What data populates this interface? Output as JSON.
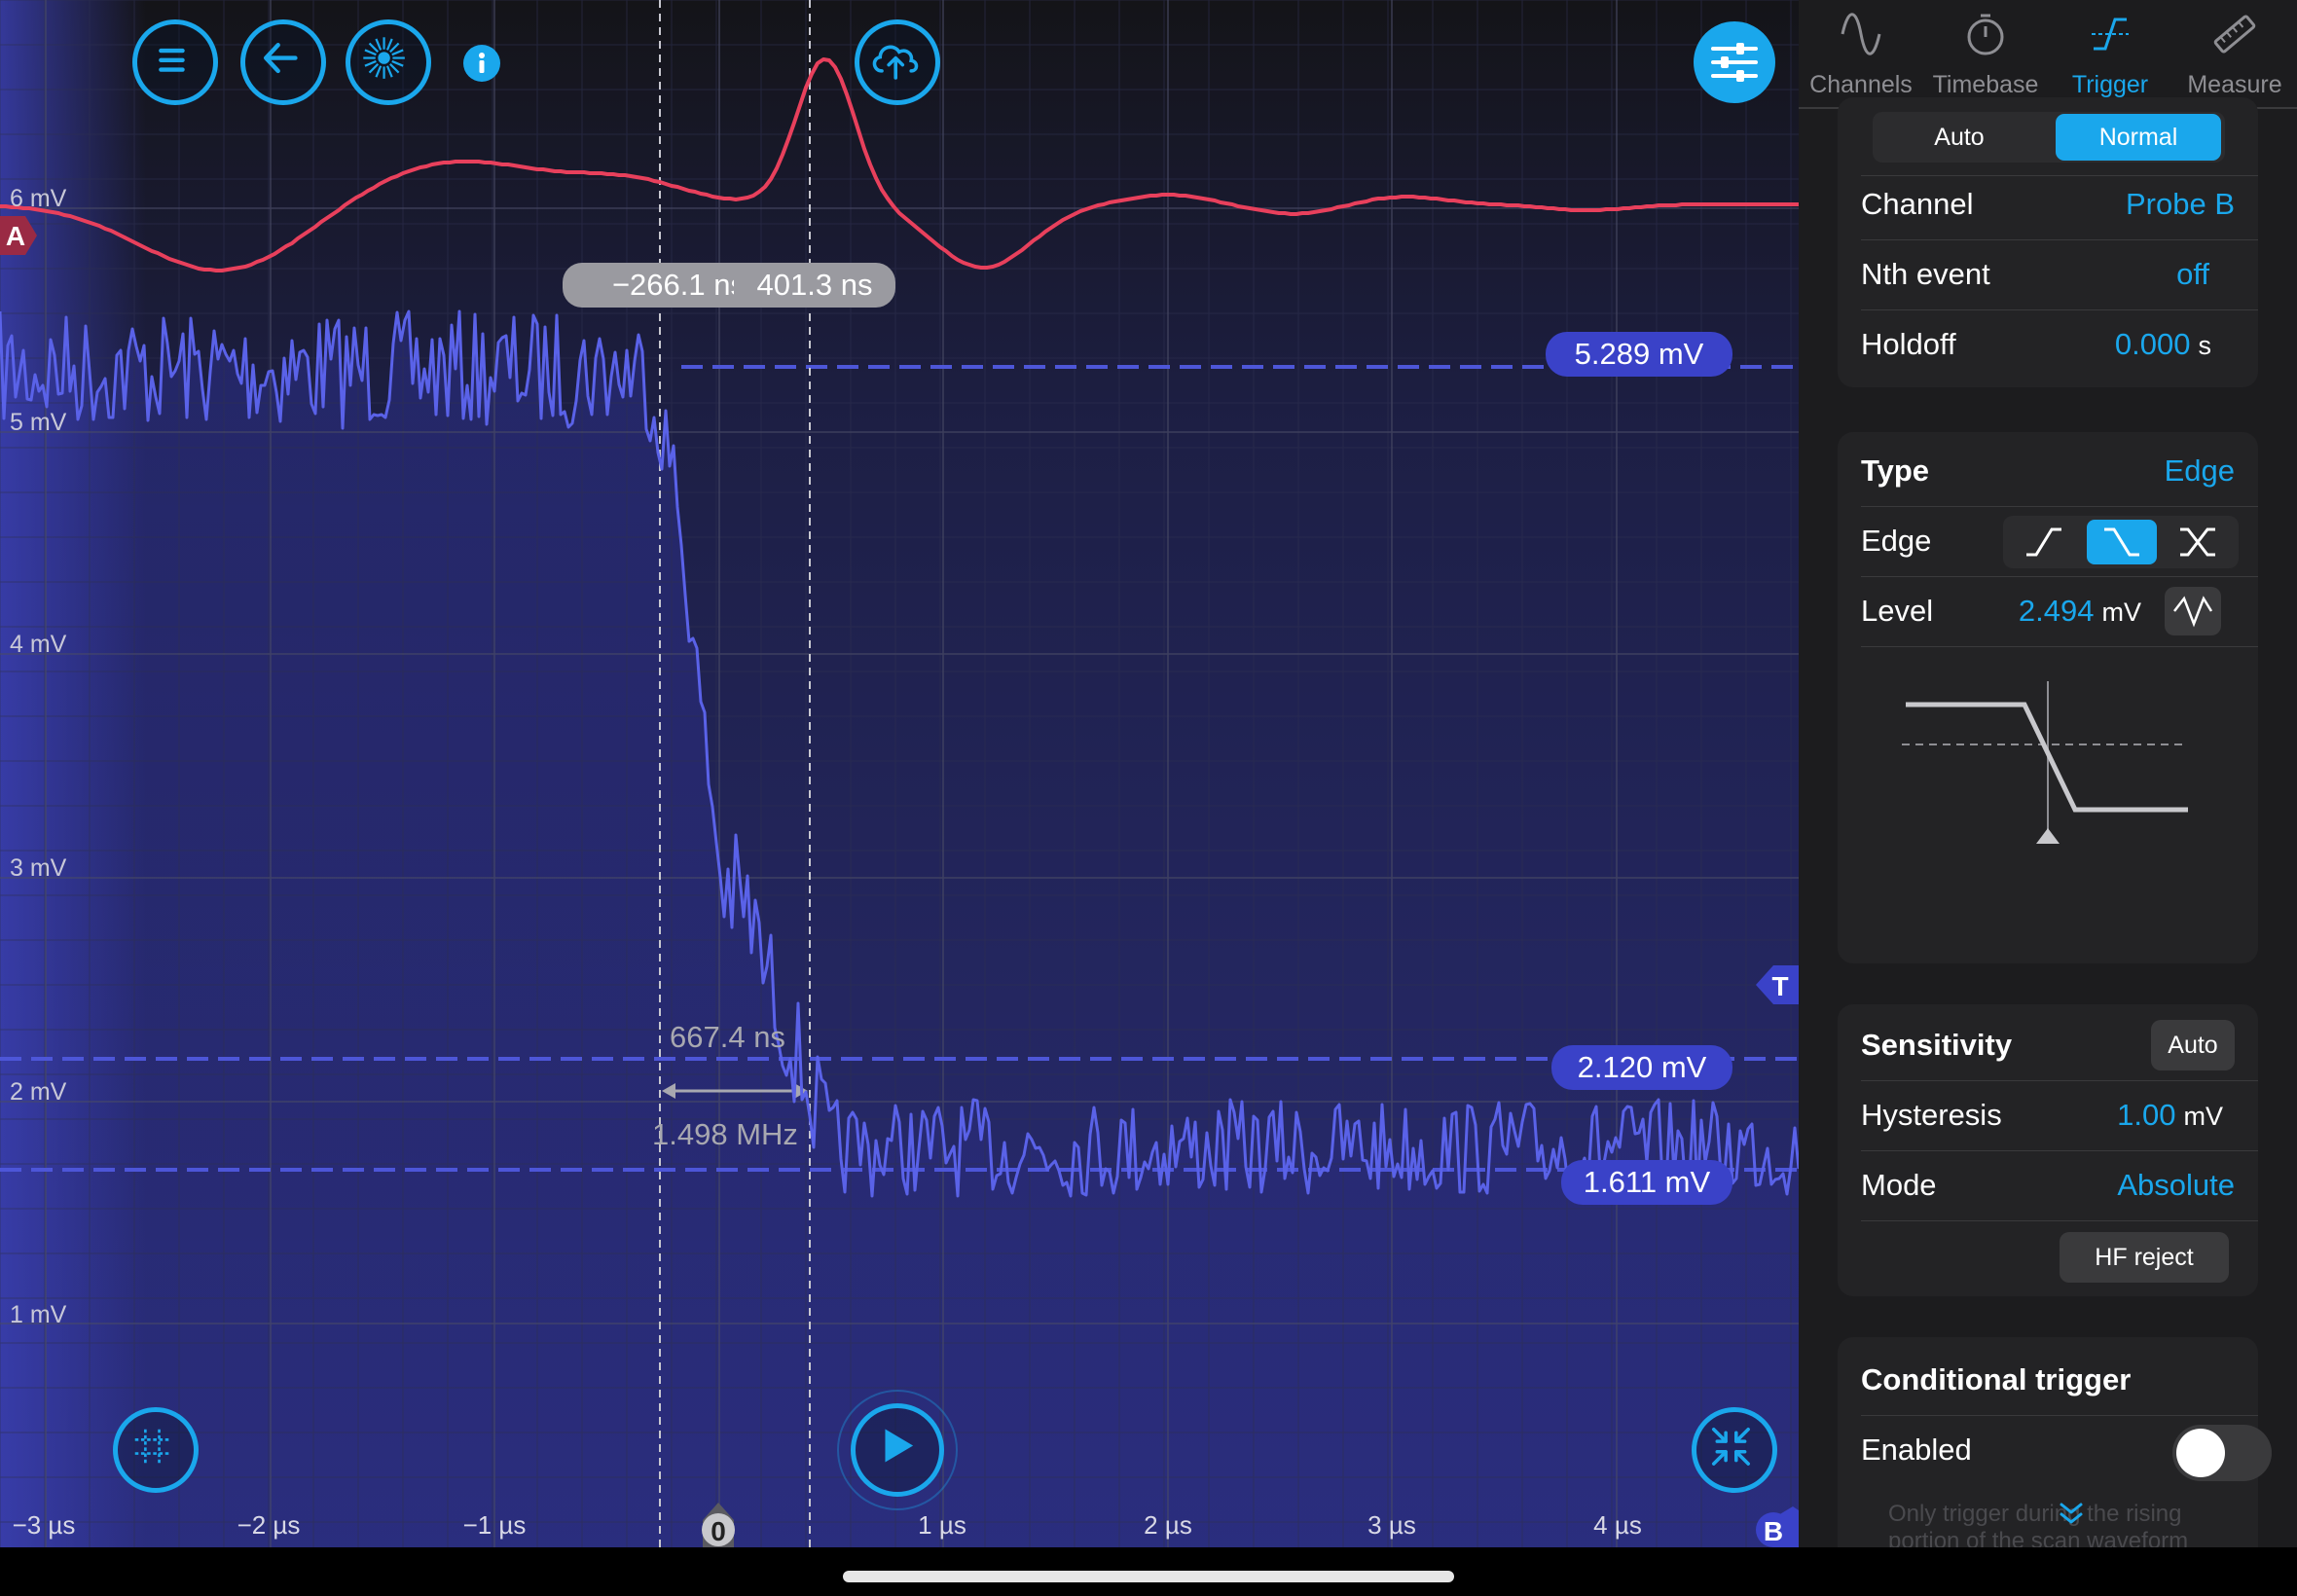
{
  "scope": {
    "y_axis_labels": [
      "6 mV",
      "5 mV",
      "4 mV",
      "3 mV",
      "2 mV",
      "1 mV"
    ],
    "x_axis_labels": [
      "−3 µs",
      "−2 µs",
      "−1 µs",
      "1 µs",
      "2 µs",
      "3 µs",
      "4 µs"
    ],
    "trigger_marker_label": "0",
    "channel_a_marker": "A",
    "channel_b_marker": "B",
    "trigger_level_marker": "T",
    "cursor_left_readout": "−266.1 ns",
    "cursor_right_readout": "401.3 ns",
    "delta_time": "667.4 ns",
    "delta_freq": "1.498 MHz",
    "level_tags": [
      "5.289 mV",
      "2.120 mV",
      "1.611 mV"
    ],
    "colors": {
      "channel_a": "#e8405c",
      "channel_b": "#5a62e8",
      "accent": "#1aa7ec"
    }
  },
  "toolbar": {
    "icons": [
      "menu-icon",
      "back-arrow-icon",
      "starburst-icon",
      "info-icon",
      "cloud-upload-icon",
      "sliders-icon"
    ],
    "bottom_icons": [
      "grid-icon",
      "play-icon",
      "collapse-icon"
    ]
  },
  "panel": {
    "tabs": [
      {
        "label": "Channels",
        "icon": "sine-wave-icon"
      },
      {
        "label": "Timebase",
        "icon": "stopwatch-icon"
      },
      {
        "label": "Trigger",
        "icon": "trigger-edge-icon"
      },
      {
        "label": "Measure",
        "icon": "ruler-icon"
      }
    ],
    "active_tab": "Trigger",
    "trigger_mode": {
      "options": [
        "Auto",
        "Normal"
      ],
      "selected": "Normal"
    },
    "channel": {
      "label": "Channel",
      "value": "Probe B"
    },
    "nth_event": {
      "label": "Nth event",
      "value": "off"
    },
    "holdoff": {
      "label": "Holdoff",
      "value": "0.000",
      "unit": "s"
    },
    "type": {
      "label": "Type",
      "value": "Edge"
    },
    "edge": {
      "label": "Edge",
      "selected": "falling"
    },
    "level": {
      "label": "Level",
      "value": "2.494",
      "unit": "mV"
    },
    "sensitivity": {
      "label": "Sensitivity",
      "button": "Auto"
    },
    "hysteresis": {
      "label": "Hysteresis",
      "value": "1.00",
      "unit": "mV"
    },
    "mode": {
      "label": "Mode",
      "value": "Absolute"
    },
    "hf_reject": "HF reject",
    "conditional": {
      "label": "Conditional trigger",
      "enabled_label": "Enabled",
      "enabled": false,
      "hint": "Only trigger during the rising portion of the scan waveform"
    }
  }
}
